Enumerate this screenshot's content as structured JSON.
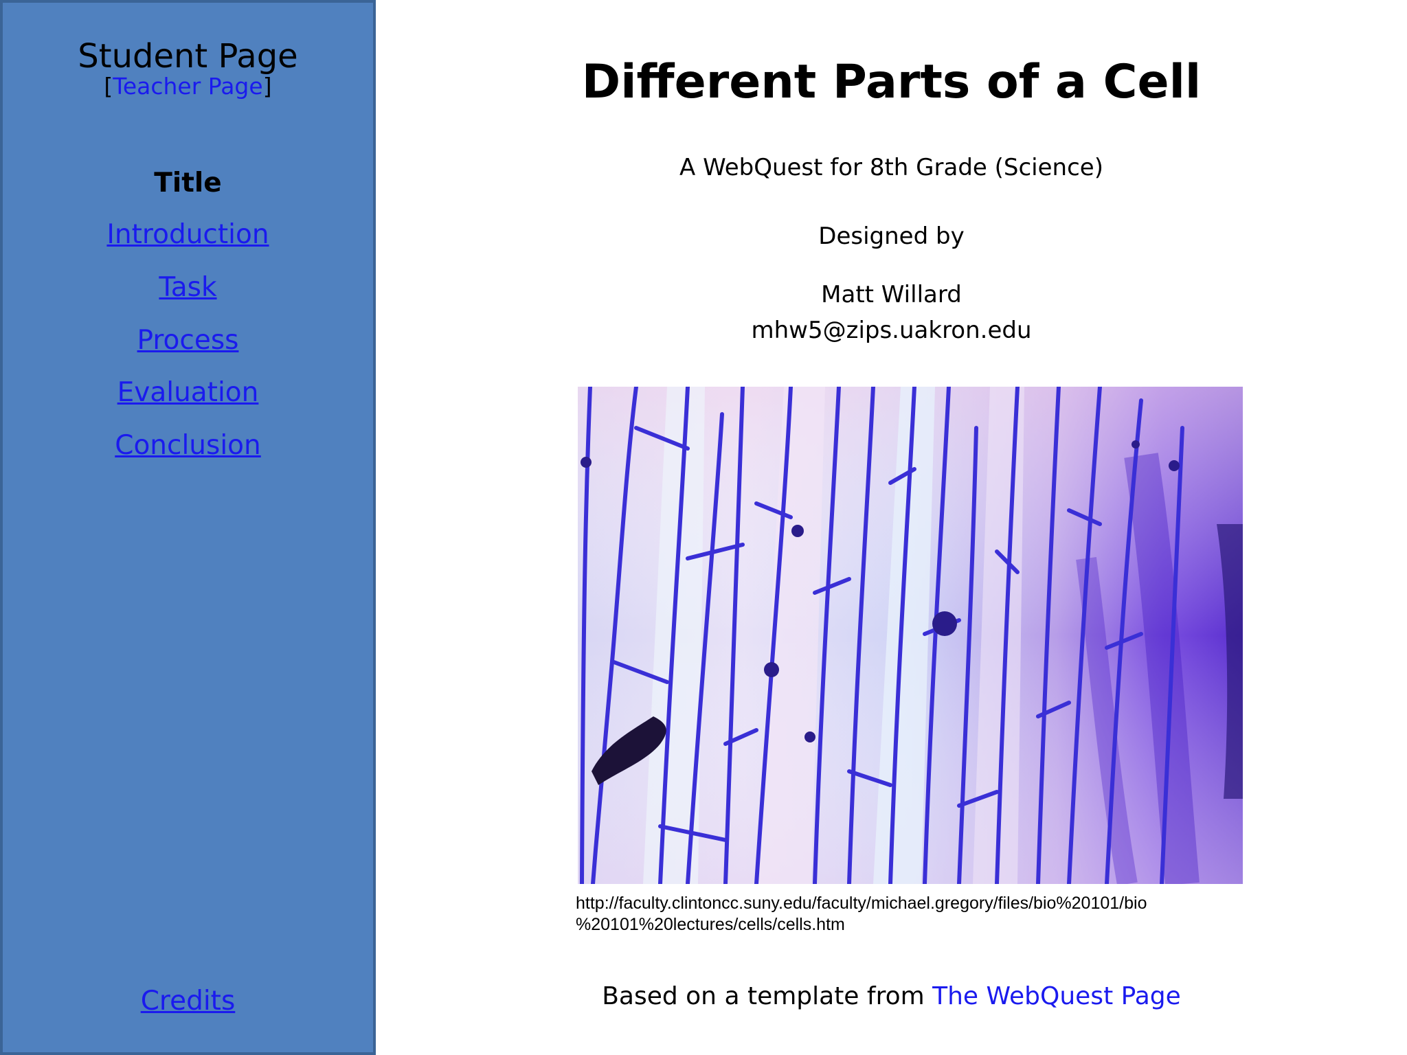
{
  "sidebar": {
    "title": "Student Page",
    "teacher_open": "[",
    "teacher_link": "Teacher Page",
    "teacher_close": "]",
    "nav": [
      {
        "label": "Title",
        "current": true
      },
      {
        "label": "Introduction",
        "current": false
      },
      {
        "label": "Task",
        "current": false
      },
      {
        "label": "Process",
        "current": false
      },
      {
        "label": "Evaluation",
        "current": false
      },
      {
        "label": "Conclusion",
        "current": false
      }
    ],
    "credits": "Credits"
  },
  "main": {
    "title": "Different Parts of a Cell",
    "subtitle": "A WebQuest for 8th Grade (Science)",
    "designed_by": "Designed by",
    "author": "Matt Willard",
    "email": "mhw5@zips.uakron.edu",
    "image_source_line1": "http://faculty.clintoncc.suny.edu/faculty/michael.gregory/files/bio%20101/bio",
    "image_source_line2": "%20101%20lectures/cells/cells.htm",
    "footer_prefix": "Based on a template from ",
    "footer_link": "The WebQuest Page"
  },
  "colors": {
    "sidebar_bg": "#5081bf",
    "link": "#1a1aee",
    "cell_wall": "#3a2fd6"
  }
}
